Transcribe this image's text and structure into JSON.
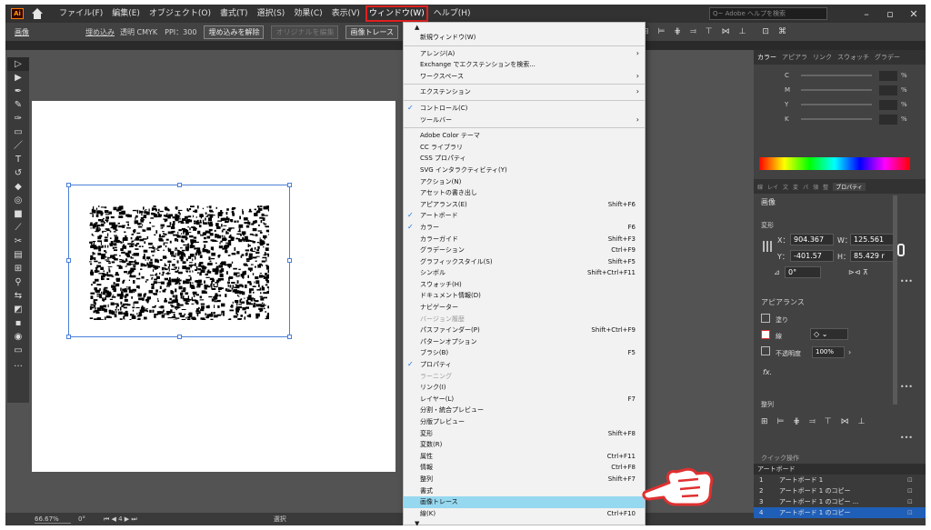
{
  "menubar": {
    "logo": "Ai",
    "items": [
      {
        "label": "ファイル(F)"
      },
      {
        "label": "編集(E)"
      },
      {
        "label": "オブジェクト(O)"
      },
      {
        "label": "書式(T)"
      },
      {
        "label": "選択(S)"
      },
      {
        "label": "効果(C)"
      },
      {
        "label": "表示(V)"
      },
      {
        "label": "ウィンドウ(W)",
        "active": true
      },
      {
        "label": "ヘルプ(H)"
      }
    ],
    "search_placeholder": "Adobe ヘルプを検索"
  },
  "controlbar": {
    "object_type": "画像",
    "embed": "埋め込み",
    "info": "透明 CMYK　PPI：300",
    "unembed_button": "埋め込みを解除",
    "edit_original_button": "オリジナルを編集",
    "image_trace_button": "画像トレース"
  },
  "window_menu": {
    "items": [
      {
        "label": "新規ウィンドウ(W)"
      },
      {
        "sep": true
      },
      {
        "label": "アレンジ(A)",
        "submenu": true
      },
      {
        "label": "Exchange でエクステンションを検索..."
      },
      {
        "label": "ワークスペース",
        "submenu": true
      },
      {
        "sep": true
      },
      {
        "label": "エクステンション",
        "submenu": true
      },
      {
        "sep": true
      },
      {
        "label": "コントロール(C)",
        "checked": true
      },
      {
        "label": "ツールバー",
        "submenu": true
      },
      {
        "sep": true
      },
      {
        "label": "Adobe Color テーマ"
      },
      {
        "label": "CC ライブラリ"
      },
      {
        "label": "CSS プロパティ"
      },
      {
        "label": "SVG インタラクティビティ(Y)"
      },
      {
        "label": "アクション(N)"
      },
      {
        "label": "アセットの書き出し"
      },
      {
        "label": "アピアランス(E)",
        "shortcut": "Shift+F6"
      },
      {
        "label": "アートボード",
        "checked": true
      },
      {
        "label": "カラー",
        "checked": true,
        "shortcut": "F6"
      },
      {
        "label": "カラーガイド",
        "shortcut": "Shift+F3"
      },
      {
        "label": "グラデーション",
        "shortcut": "Ctrl+F9"
      },
      {
        "label": "グラフィックスタイル(S)",
        "shortcut": "Shift+F5"
      },
      {
        "label": "シンボル",
        "shortcut": "Shift+Ctrl+F11"
      },
      {
        "label": "スウォッチ(H)"
      },
      {
        "label": "ドキュメント情報(D)"
      },
      {
        "label": "ナビゲーター"
      },
      {
        "label": "バージョン履歴",
        "disabled": true
      },
      {
        "label": "パスファインダー(P)",
        "shortcut": "Shift+Ctrl+F9"
      },
      {
        "label": "パターンオプション"
      },
      {
        "label": "ブラシ(B)",
        "shortcut": "F5"
      },
      {
        "label": "プロパティ",
        "checked": true
      },
      {
        "label": "ラーニング",
        "disabled": true
      },
      {
        "label": "リンク(I)"
      },
      {
        "label": "レイヤー(L)",
        "shortcut": "F7"
      },
      {
        "label": "分割・統合プレビュー"
      },
      {
        "label": "分版プレビュー"
      },
      {
        "label": "変形",
        "shortcut": "Shift+F8"
      },
      {
        "label": "変数(R)"
      },
      {
        "label": "属性",
        "shortcut": "Ctrl+F11"
      },
      {
        "label": "情報",
        "shortcut": "Ctrl+F8"
      },
      {
        "label": "整列",
        "shortcut": "Shift+F7"
      },
      {
        "label": "書式"
      },
      {
        "label": "画像トレース",
        "highlighted": true
      },
      {
        "label": "線(K)",
        "shortcut": "Ctrl+F10"
      }
    ]
  },
  "color_panel": {
    "tabs": [
      "カラー",
      "アピアラ",
      "リンク",
      "スウォッチ",
      "グラデー"
    ],
    "channels": [
      {
        "label": "C",
        "pct": "%"
      },
      {
        "label": "M",
        "pct": "%"
      },
      {
        "label": "Y",
        "pct": "%"
      },
      {
        "label": "K",
        "pct": "%"
      }
    ]
  },
  "properties_panel": {
    "tabs": [
      "線",
      "レイ",
      "文",
      "変",
      "パ",
      "領",
      "整",
      "プロパティ"
    ],
    "object_type": "画像",
    "transform_label": "変形",
    "x_label": "X：",
    "x_value": "904.367",
    "w_label": "W：",
    "w_value": "125.561",
    "y_label": "Y：",
    "y_value": "-401.57",
    "h_label": "H：",
    "h_value": "85.429 r",
    "angle_value": "0°",
    "appearance_label": "アピアランス",
    "fill_label": "塗り",
    "stroke_label": "線",
    "opacity_label": "不透明度",
    "opacity_value": "100%",
    "fx_label": "fx.",
    "align_label": "整列",
    "quick_actions_label": "クイック操作"
  },
  "artboards_panel": {
    "title": "アートボード",
    "rows": [
      {
        "num": "1",
        "name": "アートボード 1"
      },
      {
        "num": "2",
        "name": "アートボード 1 のコピー"
      },
      {
        "num": "3",
        "name": "アートボード 1 のコピー ..."
      },
      {
        "num": "4",
        "name": "アートボード 1 のコピー"
      }
    ]
  },
  "statusbar": {
    "zoom": "66.67%",
    "rotation": "0°",
    "page": "4",
    "selection_tool": "選択"
  }
}
